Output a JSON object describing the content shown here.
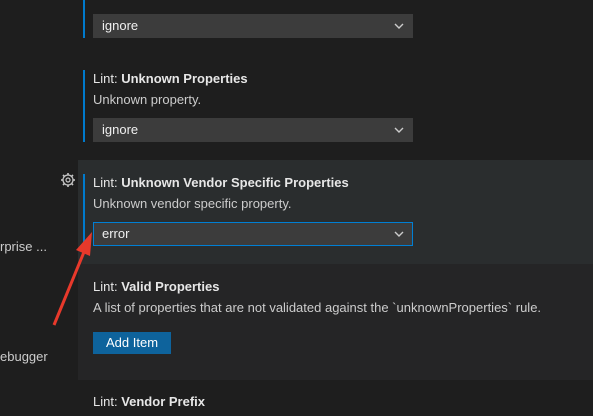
{
  "toc": {
    "item1": "rprise ...",
    "item2": "ebugger"
  },
  "settings": [
    {
      "value": "ignore"
    },
    {
      "category": "Lint: ",
      "name": "Unknown Properties",
      "description": "Unknown property.",
      "value": "ignore"
    },
    {
      "category": "Lint: ",
      "name": "Unknown Vendor Specific Properties",
      "description": "Unknown vendor specific property.",
      "value": "error"
    },
    {
      "category": "Lint: ",
      "name": "Valid Properties",
      "description": "A list of properties that are not validated against the `unknownProperties` rule.",
      "button": "Add Item"
    },
    {
      "category": "Lint: ",
      "name": "Vendor Prefix"
    }
  ],
  "colors": {
    "accent": "#007acc",
    "annotation_arrow": "#e8392b",
    "button": "#0e639c"
  },
  "icons": {
    "gear": "gear-icon",
    "chevron": "chevron-down-icon"
  }
}
